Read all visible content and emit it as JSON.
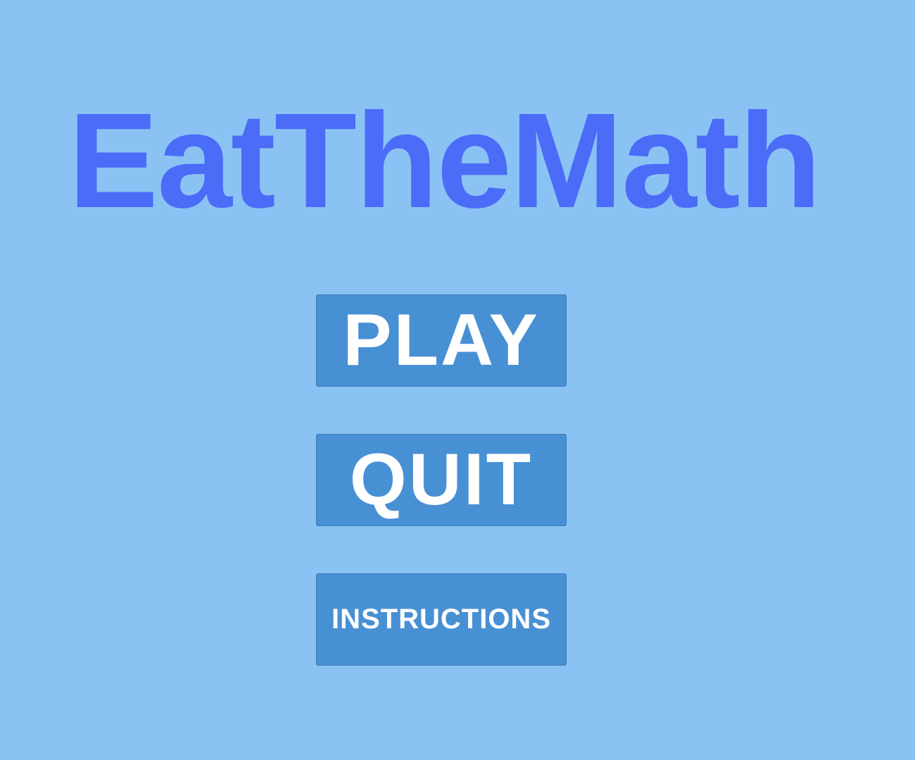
{
  "game": {
    "title": "EatTheMath",
    "background_color": "#8ac3f3",
    "title_color": "#4a6cf7",
    "button_color": "#4890d4",
    "button_text_color": "#ffffff"
  },
  "menu": {
    "play_label": "PLAY",
    "quit_label": "QUIT",
    "instructions_label": "INSTRUCTIONS"
  }
}
